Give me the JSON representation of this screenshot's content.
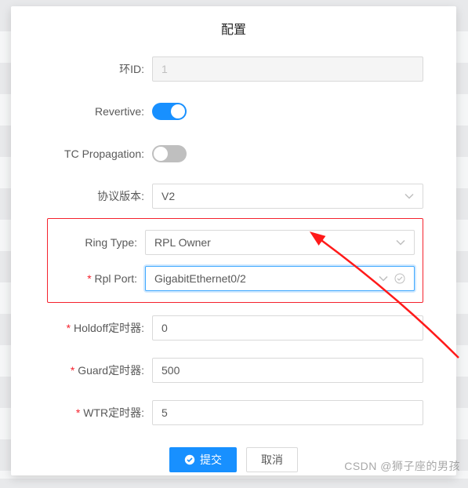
{
  "modal": {
    "title": "配置"
  },
  "fields": {
    "ring_id": {
      "label": "环ID:",
      "value": "1"
    },
    "revertive": {
      "label": "Revertive:",
      "on": true
    },
    "tc_prop": {
      "label": "TC Propagation:",
      "on": false
    },
    "proto_ver": {
      "label": "协议版本:",
      "value": "V2"
    },
    "ring_type": {
      "label": "Ring Type:",
      "value": "RPL Owner"
    },
    "rpl_port": {
      "label": "Rpl Port:",
      "value": "GigabitEthernet0/2"
    },
    "holdoff": {
      "label": "Holdoff定时器:",
      "value": "0"
    },
    "guard": {
      "label": "Guard定时器:",
      "value": "500"
    },
    "wtr": {
      "label": "WTR定时器:",
      "value": "5"
    }
  },
  "buttons": {
    "submit": "提交",
    "cancel": "取消"
  },
  "watermark": "CSDN @狮子座的男孩"
}
